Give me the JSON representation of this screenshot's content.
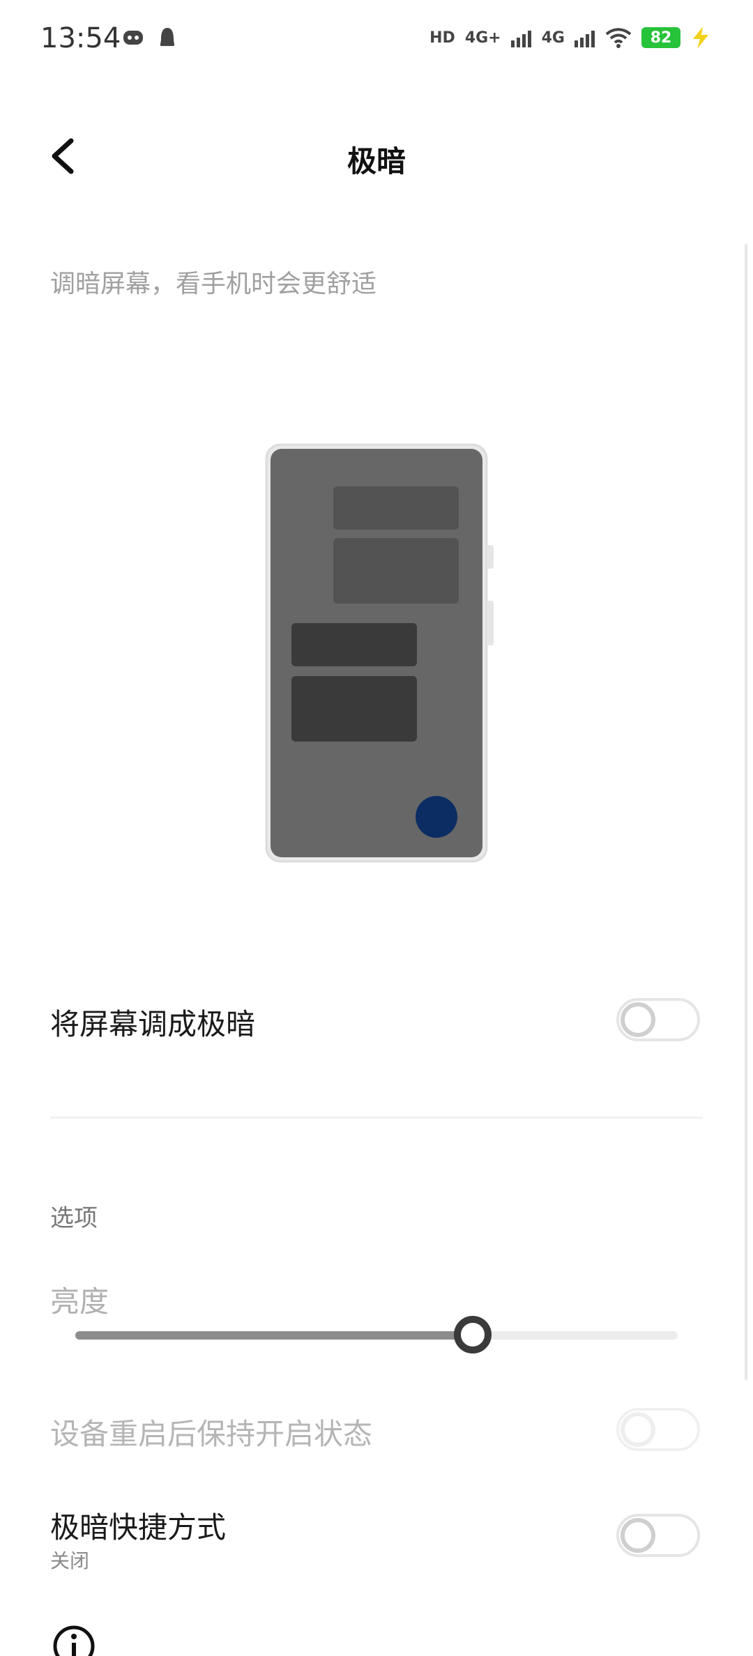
{
  "status_bar": {
    "time": "13:54",
    "hd_badge": "HD",
    "signal_1": "4G+",
    "signal_2": "4G",
    "battery": "82"
  },
  "header": {
    "title": "极暗",
    "back_icon": "chevron-left-icon"
  },
  "description": "调暗屏幕，看手机时会更舒适",
  "main_toggle": {
    "label": "将屏幕调成极暗",
    "enabled": false
  },
  "options": {
    "section_title": "选项",
    "brightness": {
      "label": "亮度",
      "value_percent": 66
    },
    "keep_after_restart": {
      "label": "设备重启后保持开启状态",
      "enabled": false,
      "disabled": true
    },
    "shortcut": {
      "label": "极暗快捷方式",
      "status": "关闭",
      "enabled": false
    }
  },
  "colors": {
    "accent_dot": "#0b2d63",
    "battery_green": "#27c33a"
  }
}
